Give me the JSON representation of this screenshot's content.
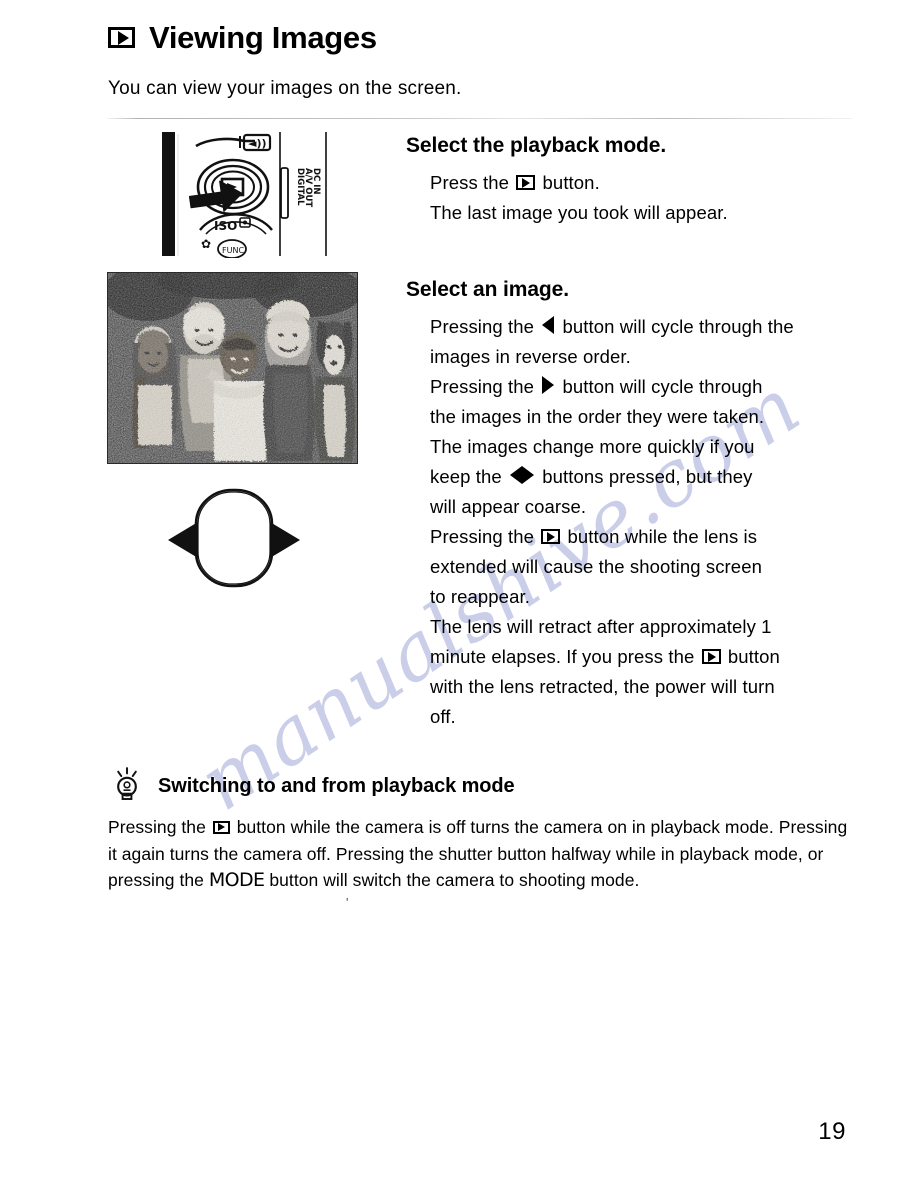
{
  "page": {
    "number": "19",
    "watermark": "manualshive.com",
    "stray_mark": "'"
  },
  "header": {
    "icon": "playback-button-icon",
    "title": "Viewing Images",
    "intro": "You can view your images on the screen."
  },
  "steps": [
    {
      "heading": "Select the playback mode.",
      "lines": [
        {
          "parts": [
            {
              "t": "text",
              "v": "Press the "
            },
            {
              "t": "icon",
              "v": "playback-button-icon"
            },
            {
              "t": "text",
              "v": " button."
            }
          ]
        },
        {
          "parts": [
            {
              "t": "text",
              "v": "The last image you took will appear."
            }
          ]
        }
      ]
    },
    {
      "heading": "Select an image.",
      "lines": [
        {
          "parts": [
            {
              "t": "text",
              "v": "Pressing the "
            },
            {
              "t": "icon",
              "v": "left-arrow-icon"
            },
            {
              "t": "text",
              "v": " button will cycle through the"
            }
          ]
        },
        {
          "parts": [
            {
              "t": "text",
              "v": "images in reverse order."
            }
          ]
        },
        {
          "parts": [
            {
              "t": "text",
              "v": "Pressing the "
            },
            {
              "t": "icon",
              "v": "right-arrow-icon"
            },
            {
              "t": "text",
              "v": " button will cycle through"
            }
          ]
        },
        {
          "parts": [
            {
              "t": "text",
              "v": "the images in the order they were taken."
            }
          ]
        },
        {
          "parts": [
            {
              "t": "text",
              "v": "The images change more quickly if you"
            }
          ]
        },
        {
          "parts": [
            {
              "t": "text",
              "v": "keep the "
            },
            {
              "t": "icon",
              "v": "left-right-arrows-icon"
            },
            {
              "t": "text",
              "v": " buttons pressed, but they"
            }
          ]
        },
        {
          "parts": [
            {
              "t": "text",
              "v": "will appear coarse."
            }
          ]
        },
        {
          "parts": [
            {
              "t": "text",
              "v": "Pressing the "
            },
            {
              "t": "icon",
              "v": "playback-button-icon"
            },
            {
              "t": "text",
              "v": " button while the lens is"
            }
          ]
        },
        {
          "parts": [
            {
              "t": "text",
              "v": "extended will cause the shooting screen"
            }
          ]
        },
        {
          "parts": [
            {
              "t": "text",
              "v": "to reappear."
            }
          ]
        },
        {
          "parts": [
            {
              "t": "text",
              "v": "The lens will retract after approximately 1"
            }
          ]
        },
        {
          "parts": [
            {
              "t": "text",
              "v": "minute elapses. If you press the "
            },
            {
              "t": "icon",
              "v": "playback-button-icon"
            },
            {
              "t": "text",
              "v": " button"
            }
          ]
        },
        {
          "parts": [
            {
              "t": "text",
              "v": "with the lens retracted, the power will turn"
            }
          ]
        },
        {
          "parts": [
            {
              "t": "text",
              "v": "off."
            }
          ]
        }
      ]
    }
  ],
  "tip": {
    "icon": "lightbulb-icon",
    "heading": "Switching to and from playback mode",
    "body_parts": [
      {
        "t": "text",
        "v": "Pressing the "
      },
      {
        "t": "icon",
        "v": "playback-button-icon"
      },
      {
        "t": "text",
        "v": " button while the camera is off turns the camera on in playback mode. Pressing it again turns the camera off. Pressing the shutter button halfway while in playback mode, or pressing the "
      },
      {
        "t": "mode",
        "v": "MODE"
      },
      {
        "t": "text",
        "v": " button will switch the camera to shooting mode."
      }
    ]
  },
  "camera_figure": {
    "name": "camera-back-illustration",
    "labels": [
      "DC IN",
      "A/V OUT",
      "DIGITAL",
      "ISO"
    ],
    "callout": "arrow-pointing-to-playback-button"
  },
  "photo_figure": {
    "name": "sample-photo-group-of-people-with-dog",
    "description": "Black and white halftone photograph of five people and a dog"
  },
  "pad_figure": {
    "name": "control-pad-left-right-diagram",
    "arrows": [
      "left-arrow",
      "right-arrow"
    ]
  },
  "colors": {
    "ink": "#000000",
    "paper": "#ffffff",
    "watermark": "#b9bee2"
  }
}
